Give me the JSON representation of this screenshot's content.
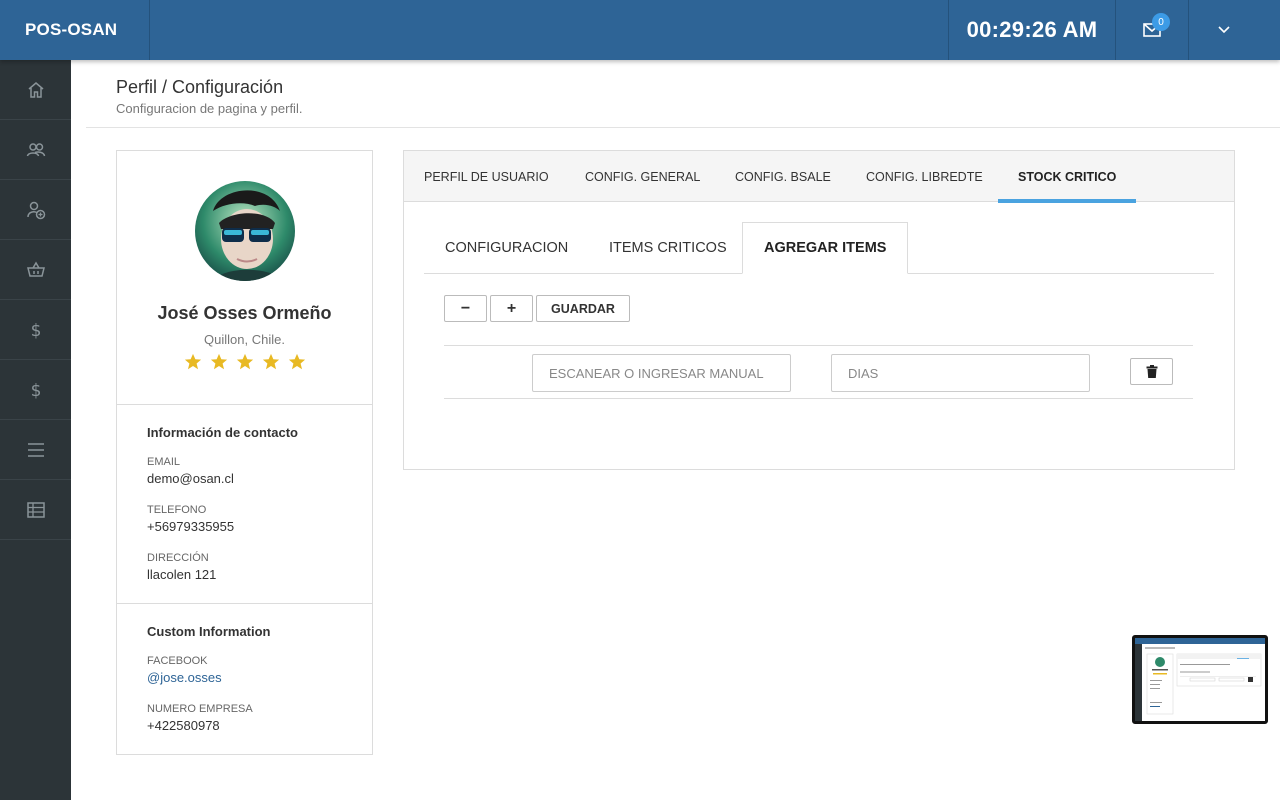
{
  "topbar": {
    "brand": "POS-OSAN",
    "clock": "00:29:26 AM",
    "mail_count": "0"
  },
  "sidebar": {
    "items": [
      {
        "icon": "home-icon"
      },
      {
        "icon": "users-icon"
      },
      {
        "icon": "add-user-icon"
      },
      {
        "icon": "basket-icon"
      },
      {
        "icon": "dollar-icon"
      },
      {
        "icon": "dollar-icon"
      },
      {
        "icon": "menu-icon"
      },
      {
        "icon": "table-icon"
      }
    ]
  },
  "page": {
    "title": "Perfil / Configuración",
    "subtitle": "Configuracion de pagina y perfil."
  },
  "profile": {
    "name": "José Osses Ormeño",
    "location": "Quillon, Chile.",
    "rating": 5,
    "contact_title": "Información de contacto",
    "email_label": "EMAIL",
    "email": "demo@osan.cl",
    "phone_label": "TELEFONO",
    "phone": "+56979335955",
    "address_label": "DIRECCIÓN",
    "address": "llacolen 121",
    "custom_title": "Custom Information",
    "facebook_label": "FACEBOOK",
    "facebook": "@jose.osses",
    "company_label": "NUMERO EMPRESA",
    "company_number": "+422580978"
  },
  "tabs": [
    {
      "label": "PERFIL DE USUARIO"
    },
    {
      "label": "CONFIG. GENERAL"
    },
    {
      "label": "CONFIG. BSALE"
    },
    {
      "label": "CONFIG. LIBREDTE"
    },
    {
      "label": "STOCK CRITICO"
    }
  ],
  "active_tab": "STOCK CRITICO",
  "subtabs": [
    {
      "label": "CONFIGURACION"
    },
    {
      "label": "ITEMS CRITICOS"
    },
    {
      "label": "AGREGAR ITEMS"
    }
  ],
  "active_subtab": "AGREGAR ITEMS",
  "form": {
    "minus_label": "−",
    "plus_label": "+",
    "save_label": "GUARDAR",
    "scan_placeholder": "ESCANEAR O INGRESAR MANUAL",
    "days_placeholder": "DIAS"
  },
  "colors": {
    "topbar": "#2e6496",
    "sidebar": "#2c3438",
    "accent": "#4aa3e0",
    "star": "#e8b923"
  }
}
